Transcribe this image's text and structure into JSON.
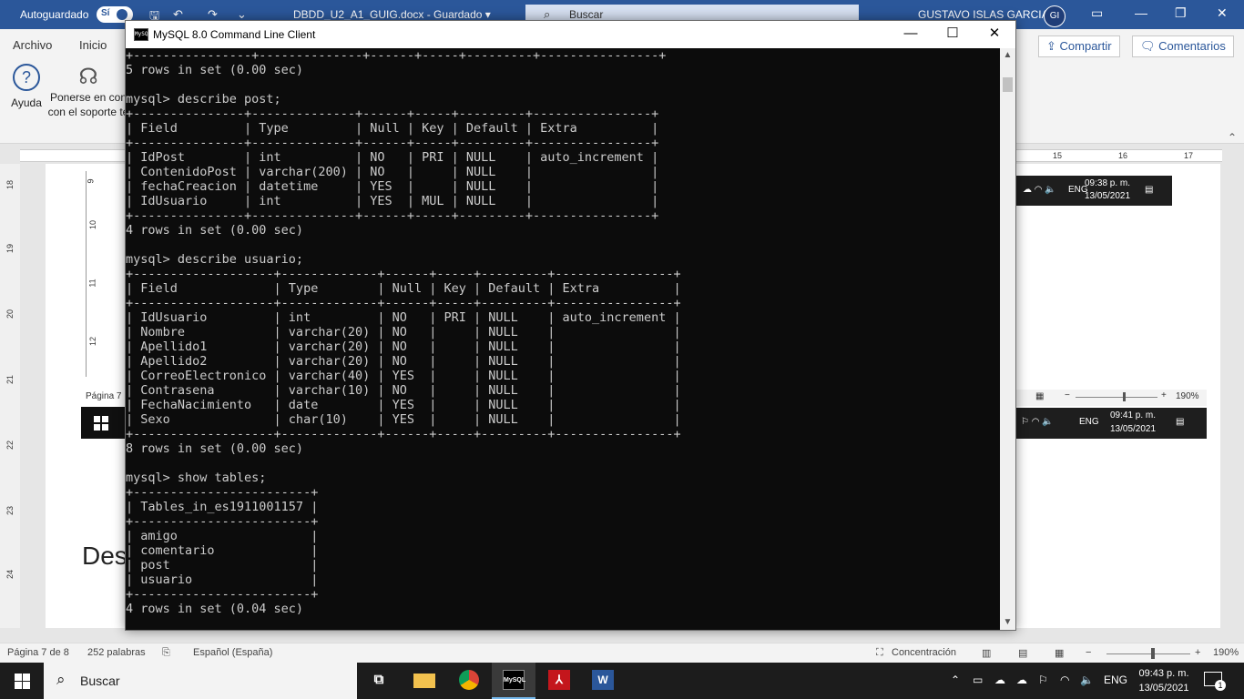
{
  "word": {
    "autosave_label": "Autoguardado",
    "autosave_state": "Sí",
    "doc_title": "DBDD_U2_A1_GUIG.docx  -  Guardado  ▾",
    "search_placeholder": "Buscar",
    "user_name": "GUSTAVO ISLAS GARCIA",
    "user_initials": "GI",
    "ribbon": {
      "tab_file": "Archivo",
      "tab_home": "Inicio",
      "share_label": "Compartir",
      "comments_label": "Comentarios",
      "help_label": "Ayuda",
      "support_label_1": "Ponerse en con",
      "support_label_2": "con el soporte té"
    },
    "doc_text": "Des",
    "status": {
      "page": "Página 7 de 8",
      "words": "252 palabras",
      "language": "Español (España)",
      "focus": "Concentración",
      "zoom": "190%"
    },
    "rulers": {
      "h": [
        "15",
        "16",
        "17"
      ],
      "v": [
        "18",
        "19",
        "20",
        "21",
        "22",
        "23",
        "24"
      ]
    },
    "embedded": {
      "left_ruler": [
        "9",
        "10",
        "11",
        "12"
      ],
      "page_label": "Página 7",
      "tray1_lang": "ENG",
      "tray1_time": "09:38 p. m.",
      "tray1_date": "13/05/2021",
      "tray2_lang": "ENG",
      "tray2_time": "09:41 p. m.",
      "tray2_date": "13/05/2021",
      "zoom": "190%",
      "notif_count": "1"
    }
  },
  "console": {
    "title": "MySQL 8.0 Command Line Client",
    "app_icon_text": "MySQL",
    "lines": [
      "+----------------+--------------+------+-----+---------+----------------+",
      "5 rows in set (0.00 sec)",
      "",
      "mysql> describe post;",
      "+---------------+--------------+------+-----+---------+----------------+",
      "| Field         | Type         | Null | Key | Default | Extra          |",
      "+---------------+--------------+------+-----+---------+----------------+",
      "| IdPost        | int          | NO   | PRI | NULL    | auto_increment |",
      "| ContenidoPost | varchar(200) | NO   |     | NULL    |                |",
      "| fechaCreacion | datetime     | YES  |     | NULL    |                |",
      "| IdUsuario     | int          | YES  | MUL | NULL    |                |",
      "+---------------+--------------+------+-----+---------+----------------+",
      "4 rows in set (0.00 sec)",
      "",
      "mysql> describe usuario;",
      "+-------------------+-------------+------+-----+---------+----------------+",
      "| Field             | Type        | Null | Key | Default | Extra          |",
      "+-------------------+-------------+------+-----+---------+----------------+",
      "| IdUsuario         | int         | NO   | PRI | NULL    | auto_increment |",
      "| Nombre            | varchar(20) | NO   |     | NULL    |                |",
      "| Apellido1         | varchar(20) | NO   |     | NULL    |                |",
      "| Apellido2         | varchar(20) | NO   |     | NULL    |                |",
      "| CorreoElectronico | varchar(40) | YES  |     | NULL    |                |",
      "| Contrasena        | varchar(10) | NO   |     | NULL    |                |",
      "| FechaNacimiento   | date        | YES  |     | NULL    |                |",
      "| Sexo              | char(10)    | YES  |     | NULL    |                |",
      "+-------------------+-------------+------+-----+---------+----------------+",
      "8 rows in set (0.00 sec)",
      "",
      "mysql> show tables;",
      "+------------------------+",
      "| Tables_in_es1911001157 |",
      "+------------------------+",
      "| amigo                  |",
      "| comentario             |",
      "| post                   |",
      "| usuario                |",
      "+------------------------+",
      "4 rows in set (0.04 sec)"
    ]
  },
  "taskbar": {
    "search_placeholder": "Buscar",
    "mysql_app_label": "MySQL",
    "lang": "ENG",
    "time": "09:43 p. m.",
    "date": "13/05/2021",
    "notif_count": "1"
  },
  "colors": {
    "word_blue": "#2b579a",
    "console_bg": "#0c0c0c",
    "console_fg": "#cccccc",
    "taskbar_bg": "#1c1c1c"
  }
}
